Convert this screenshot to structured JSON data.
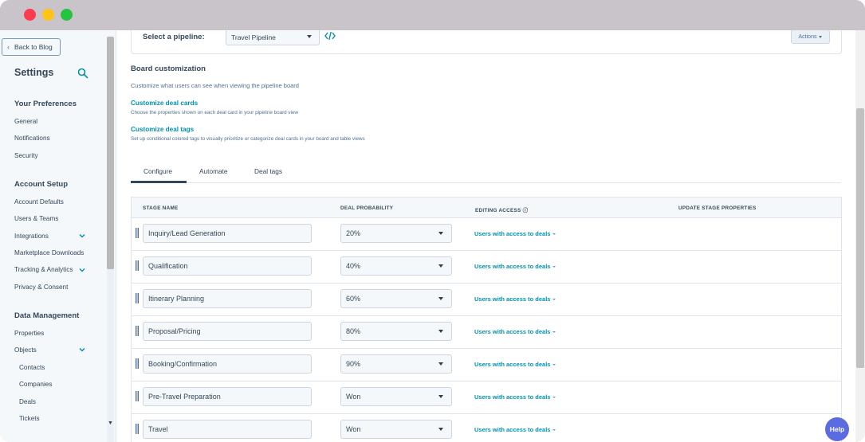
{
  "sidebar": {
    "back_label": "Back to Blog",
    "title": "Settings",
    "sections": [
      {
        "title": "Your Preferences",
        "items": [
          "General",
          "Notifications",
          "Security"
        ]
      },
      {
        "title": "Account Setup",
        "items": [
          "Account Defaults",
          "Users & Teams",
          "Integrations",
          "Marketplace Downloads",
          "Tracking & Analytics",
          "Privacy & Consent"
        ]
      },
      {
        "title": "Data Management",
        "items": [
          "Properties",
          "Objects",
          "Contacts",
          "Companies",
          "Deals",
          "Tickets"
        ]
      }
    ]
  },
  "pipeline": {
    "label": "Select a pipeline:",
    "selected": "Travel Pipeline",
    "actions_label": "Actions"
  },
  "board": {
    "title": "Board customization",
    "description": "Customize what users can see when viewing the pipeline board",
    "links": [
      {
        "title": "Customize deal cards",
        "description": "Choose the properties shown on each deal card in your pipeline board view"
      },
      {
        "title": "Customize deal tags",
        "description": "Set up conditional colored tags to visually prioritize or categorize deal cards in your board and table views"
      }
    ]
  },
  "tabs": [
    "Configure",
    "Automate",
    "Deal tags"
  ],
  "table": {
    "headers": [
      "STAGE NAME",
      "DEAL PROBABILITY",
      "EDITING ACCESS",
      "UPDATE STAGE PROPERTIES"
    ],
    "rows": [
      {
        "stage": "Inquiry/Lead Generation",
        "probability": "20%",
        "access": "Users with access to deals"
      },
      {
        "stage": "Qualification",
        "probability": "40%",
        "access": "Users with access to deals"
      },
      {
        "stage": "Itinerary Planning",
        "probability": "60%",
        "access": "Users with access to deals"
      },
      {
        "stage": "Proposal/Pricing",
        "probability": "80%",
        "access": "Users with access to deals"
      },
      {
        "stage": "Booking/Confirmation",
        "probability": "90%",
        "access": "Users with access to deals"
      },
      {
        "stage": "Pre-Travel Preparation",
        "probability": "Won",
        "access": "Users with access to deals"
      },
      {
        "stage": "Travel",
        "probability": "Won",
        "access": "Users with access to deals"
      }
    ]
  },
  "help_label": "Help",
  "colors": {
    "link": "#0091ae",
    "text": "#33475b",
    "help": "#5b6be0"
  }
}
